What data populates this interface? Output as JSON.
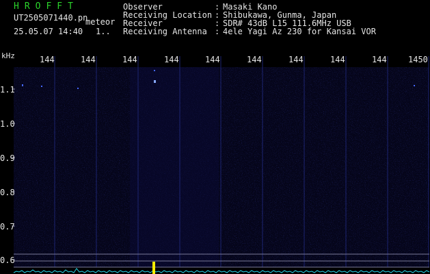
{
  "header": {
    "logo": "HROFFT",
    "filename": "UT2505071440.pn",
    "tag": "meteor",
    "datetime": "25.05.07 14:40",
    "count": "1.."
  },
  "meta": {
    "rows": [
      {
        "key": "Observer",
        "value": "Masaki Kano"
      },
      {
        "key": "Receiving Location",
        "value": "Shibukawa, Gunma, Japan"
      },
      {
        "key": "Receiver",
        "value": "SDR# 43dB L15 111.6MHz USB"
      },
      {
        "key": "Receiving Antenna",
        "value": "4ele Yagi Az 230 for Kansai VOR"
      }
    ]
  },
  "axis": {
    "unit": "kHz",
    "x_ticks": [
      "144",
      "144",
      "144",
      "144",
      "144",
      "144",
      "144",
      "144",
      "144",
      "1450"
    ],
    "y_ticks": [
      "1.1",
      "1.0",
      "0.9",
      "0.8",
      "0.7",
      "0.6"
    ]
  },
  "colors": {
    "background": "#000000",
    "spectrum_cyan": "#22d4e8",
    "spike_yellow": "#ffee00",
    "grid_blue": "#1c2470",
    "logo_green": "#2bd42b"
  }
}
